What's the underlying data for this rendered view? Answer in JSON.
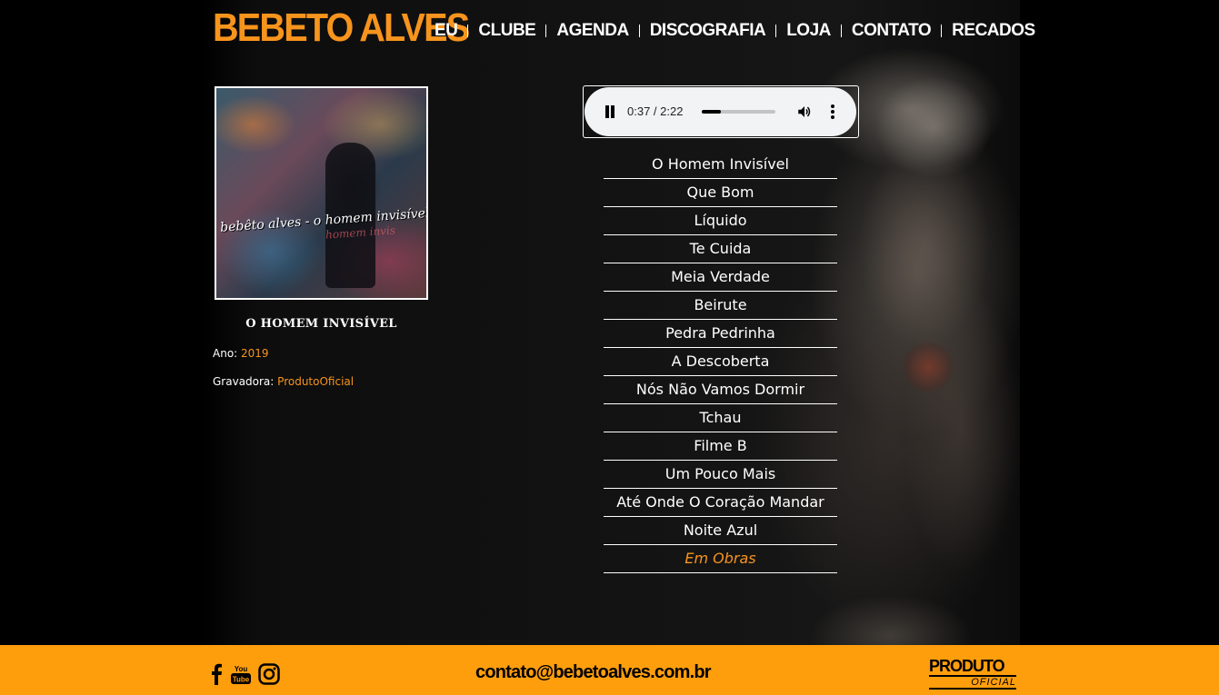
{
  "site": {
    "logo": "BEBETO ALVES"
  },
  "nav": {
    "items": [
      {
        "label": "EU"
      },
      {
        "label": "CLUBE"
      },
      {
        "label": "AGENDA"
      },
      {
        "label": "DISCOGRAFIA"
      },
      {
        "label": "LOJA"
      },
      {
        "label": "CONTATO"
      },
      {
        "label": "RECADOS"
      }
    ]
  },
  "album": {
    "cover_text": "bebêto alves - o homem invisível",
    "cover_text_echo": "homem invis",
    "title": "O HOMEM INVISÍVEL",
    "year_label": "Ano:",
    "year": "2019",
    "label_label": "Gravadora:",
    "label": "ProdutoOficial"
  },
  "player": {
    "time": "0:37 / 2:22",
    "progress": 0.26,
    "state": "playing",
    "icons": [
      "pause-icon",
      "volume-icon",
      "more-vert-icon"
    ]
  },
  "tracks": [
    {
      "title": "O Homem Invisível"
    },
    {
      "title": "Que Bom"
    },
    {
      "title": "Líquido"
    },
    {
      "title": "Te Cuida"
    },
    {
      "title": "Meia Verdade"
    },
    {
      "title": "Beirute"
    },
    {
      "title": "Pedra Pedrinha"
    },
    {
      "title": "A Descoberta"
    },
    {
      "title": "Nós Não Vamos Dormir"
    },
    {
      "title": "Tchau"
    },
    {
      "title": "Filme B"
    },
    {
      "title": "Um Pouco Mais"
    },
    {
      "title": "Até Onde O Coração Mandar"
    },
    {
      "title": "Noite Azul"
    },
    {
      "title": "Em Obras",
      "current": true
    }
  ],
  "footer": {
    "email": "contato@bebetoalves.com.br",
    "youtube_you": "You",
    "youtube_tube": "Tube",
    "produto_line1": "PRODUTO",
    "produto_line2": "OFICIAL",
    "social_icons": [
      "facebook-icon",
      "youtube-icon",
      "instagram-icon"
    ]
  },
  "colors": {
    "accent": "#f7941d",
    "footer_bg": "#ff9e0d",
    "background": "#000000"
  }
}
